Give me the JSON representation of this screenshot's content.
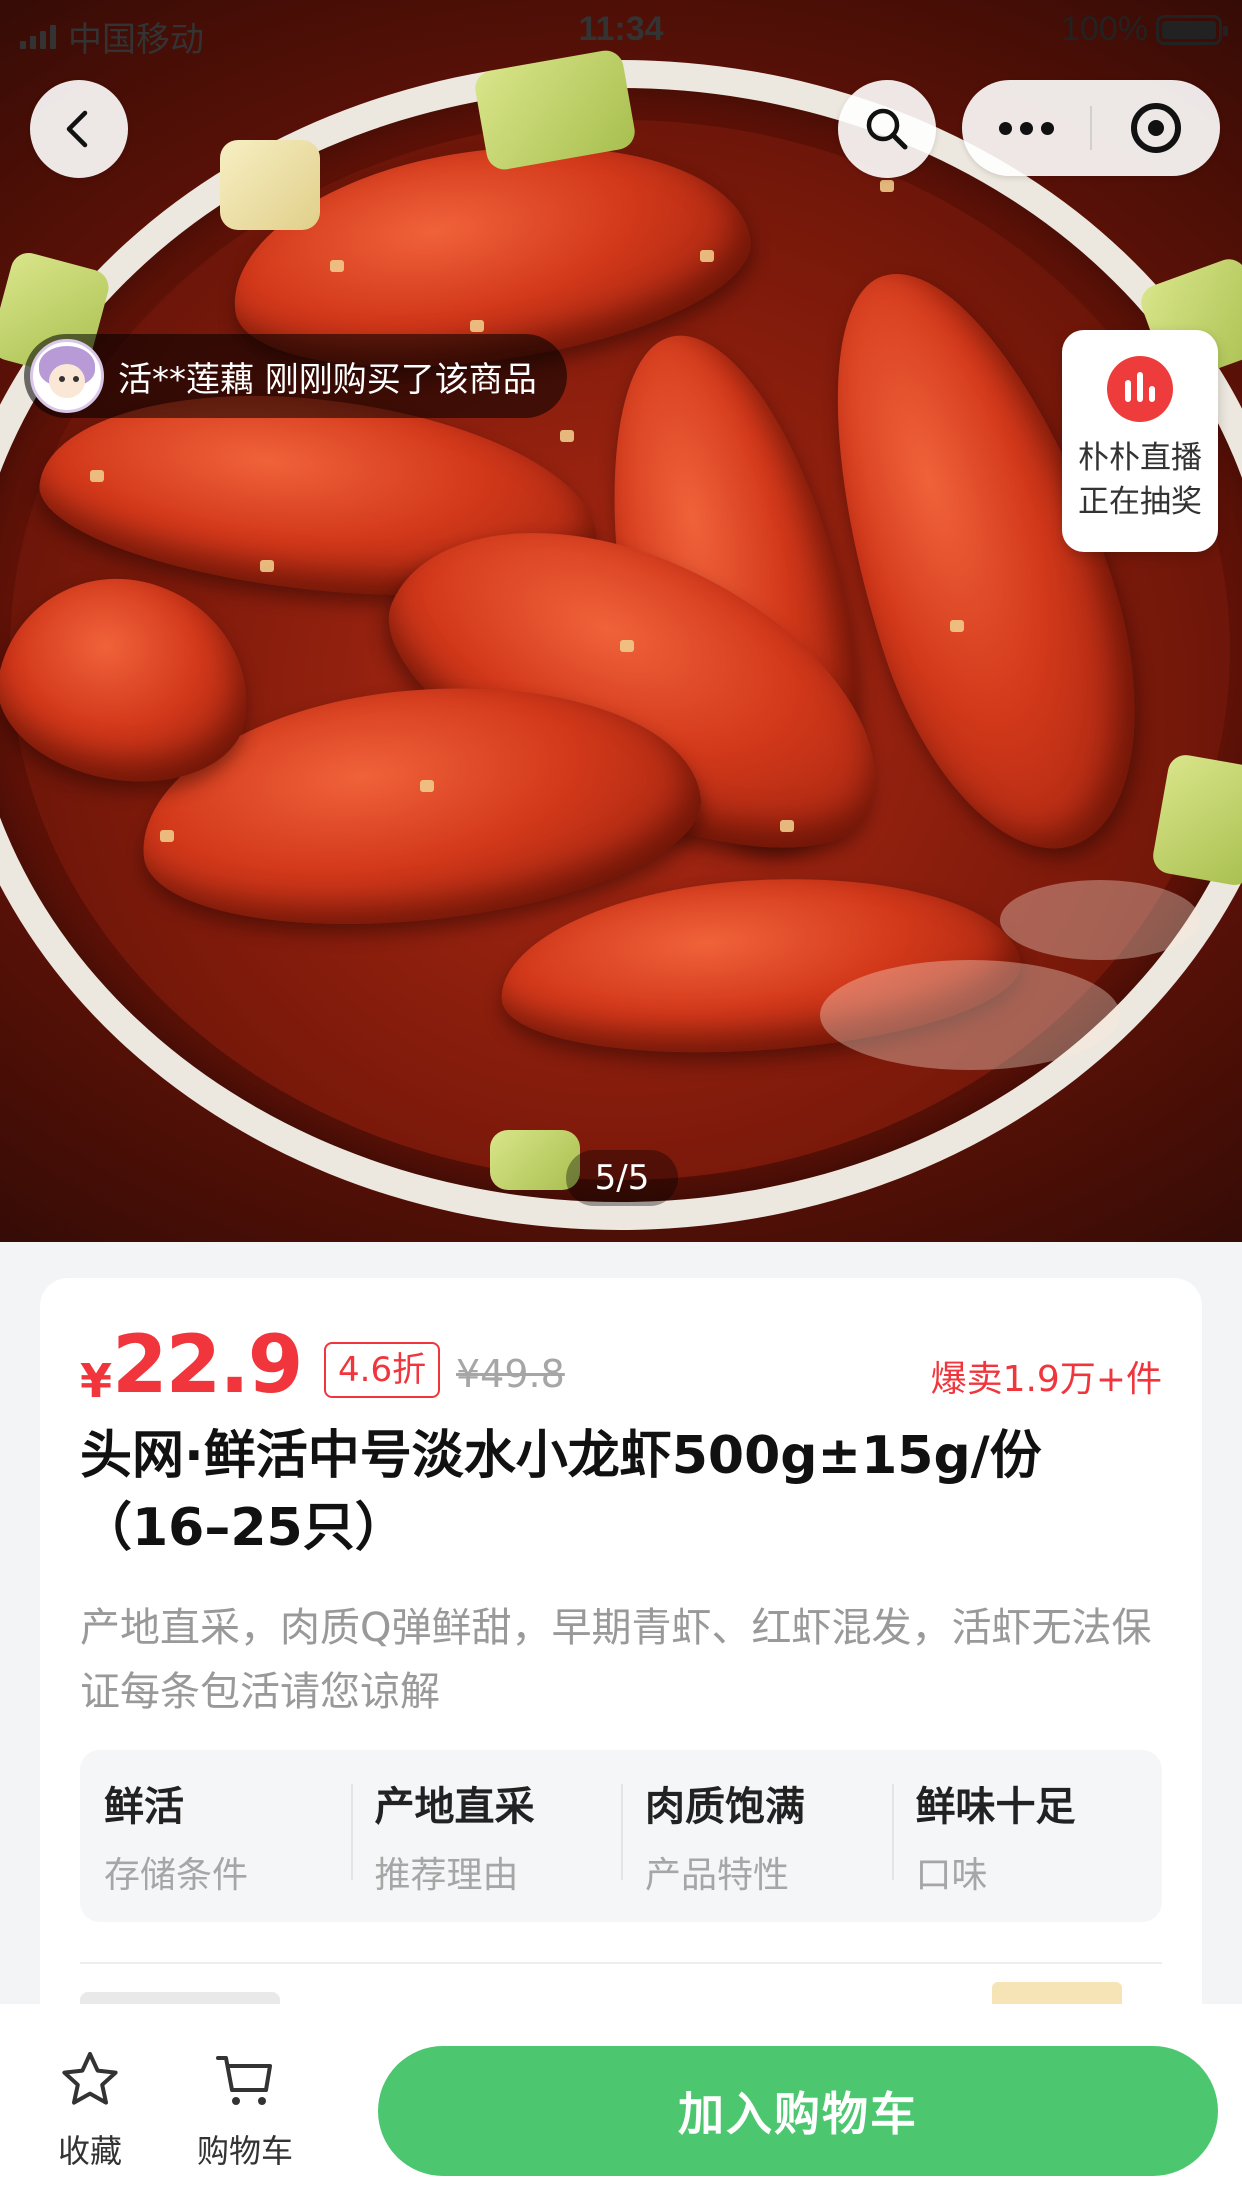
{
  "status_bar": {
    "carrier": "中国移动",
    "time": "11:34",
    "battery": "100%"
  },
  "gallery": {
    "indicator": "5/5",
    "buyer_notice": "活**莲藕 刚刚购买了该商品",
    "live_line1": "朴朴直播",
    "live_line2": "正在抽奖"
  },
  "product": {
    "currency": "¥",
    "price": "22.9",
    "discount": "4.6折",
    "original_price": "¥49.8",
    "sold": "爆卖1.9万+件",
    "title": "头网·鲜活中号淡水小龙虾500g±15g/份（16–25只）",
    "description": "产地直采，肉质Q弹鲜甜，早期青虾、红虾混发，活虾无法保证每条包活请您谅解",
    "features": [
      {
        "value": "鲜活",
        "label": "存储条件"
      },
      {
        "value": "产地直采",
        "label": "推荐理由"
      },
      {
        "value": "肉质饱满",
        "label": "产品特性"
      },
      {
        "value": "鲜味十足",
        "label": "口味"
      }
    ]
  },
  "bottom_bar": {
    "favorite_label": "收藏",
    "cart_label": "购物车",
    "add_to_cart": "加入购物车"
  },
  "colors": {
    "price_red": "#f0363c",
    "action_green": "#4dc76f",
    "live_red": "#ee3b3b"
  },
  "icons": [
    "back-icon",
    "search-icon",
    "more-icon",
    "target-icon",
    "live-icon",
    "star-icon",
    "cart-icon"
  ]
}
